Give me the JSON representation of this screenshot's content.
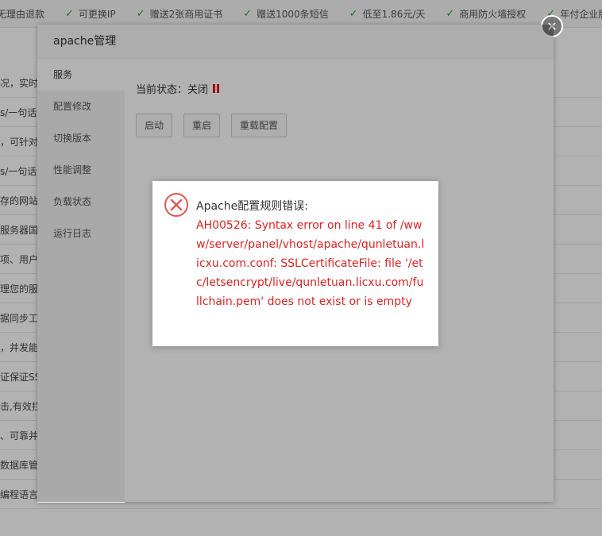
{
  "background": {
    "features": [
      {
        "label": "无理由退款",
        "icon": "check-icon"
      },
      {
        "label": "可更换IP",
        "icon": "check-icon"
      },
      {
        "label": "赠送2张商用证书",
        "icon": "check-icon"
      },
      {
        "label": "赠送1000条短信",
        "icon": "check-icon"
      },
      {
        "label": "低至1.86元/天",
        "icon": "check-icon"
      },
      {
        "label": "商用防火墙授权",
        "icon": "check-icon"
      },
      {
        "label": "年付企业版",
        "icon": "check-icon"
      }
    ],
    "rows": [
      "况，实时",
      "s/一句话",
      "，可针对",
      "s/一句话",
      "存的网站",
      "服务器国",
      "项、用户",
      "理您的服",
      "据同步工",
      "，并发能",
      "证保证SS",
      "击,有效拦",
      "、可靠并",
      "数据库管",
      "编程语言"
    ]
  },
  "dialog": {
    "title": "apache管理",
    "close_symbol": "✕",
    "menu": [
      "服务",
      "配置修改",
      "切换版本",
      "性能调整",
      "负载状态",
      "运行日志"
    ],
    "status_label": "当前状态：关闭",
    "buttons": {
      "start": "启动",
      "restart": "重启",
      "reload": "重载配置"
    }
  },
  "message": {
    "title": "Apache配置规则错误:",
    "detail": "AH00526: Syntax error on line 41 of /www/server/panel/vhost/apache/qunletuan.licxu.com.conf: SSLCertificateFile: file '/etc/letsencrypt/live/qunletuan.licxu.com/fullchain.pem' does not exist or is empty",
    "icon": "error-circle-icon",
    "icon_color": "#e8554e"
  },
  "colors": {
    "accent_green": "#20a53a",
    "status_red": "#e00000",
    "error_red": "#e02020"
  }
}
